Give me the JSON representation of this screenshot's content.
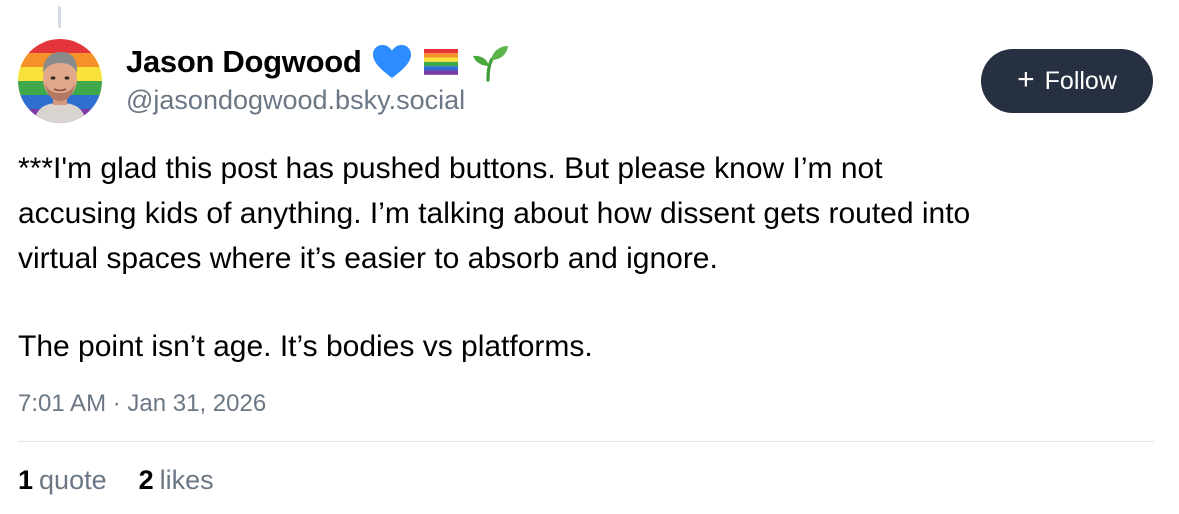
{
  "author": {
    "display_name": "Jason Dogwood",
    "handle": "@jasondogwood.bsky.social",
    "badges": [
      "blue-heart-icon",
      "rainbow-flag-icon",
      "seedling-icon"
    ]
  },
  "follow_button": {
    "icon": "plus-icon",
    "label": "Follow"
  },
  "post": {
    "paragraph_1_lines": [
      "***I'm glad this post has pushed buttons.  But please know I’m not",
      "accusing kids of anything. I’m talking about how dissent gets routed into",
      "virtual spaces where it’s easier to absorb and ignore."
    ],
    "paragraph_2": "The point isn’t age. It’s bodies vs platforms.",
    "timestamp": "7:01 AM · Jan 31, 2026"
  },
  "stats": {
    "quotes_count": "1",
    "quotes_label": "quote",
    "likes_count": "2",
    "likes_label": "likes"
  },
  "colors": {
    "button_bg": "#273040",
    "muted_text": "#6b7785",
    "heart": "#2d8cff",
    "divider": "#dfe4e9"
  }
}
